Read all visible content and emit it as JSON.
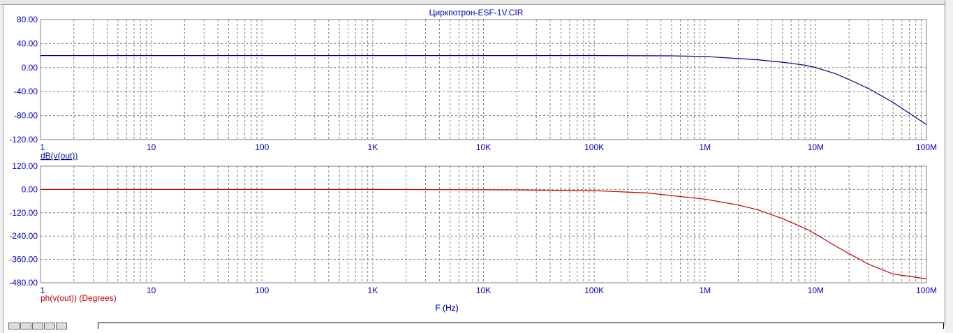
{
  "chart_data": [
    {
      "type": "line",
      "title": "Циркпотрон-ESF-1V.CIR",
      "xscale": "log",
      "xlim": [
        1,
        100000000
      ],
      "xticks": [
        "1",
        "10",
        "100",
        "1K",
        "10K",
        "100K",
        "1M",
        "10M",
        "100M"
      ],
      "xlabel": "F (Hz)",
      "ylabel": "dB(v(out))",
      "ylim": [
        -120,
        80
      ],
      "yticks": [
        "80.00",
        "40.00",
        "0.00",
        "-40.00",
        "-80.00",
        "-120.00"
      ],
      "grid": true,
      "series": [
        {
          "name": "dB(v(out))",
          "color": "#00008b",
          "x": [
            1,
            1000,
            100000,
            500000,
            1000000,
            2000000,
            3000000,
            5000000,
            8000000,
            10000000,
            15000000,
            20000000,
            30000000,
            50000000,
            100000000
          ],
          "y": [
            20,
            20,
            20,
            19.5,
            18.5,
            15,
            13,
            9,
            4,
            0,
            -10,
            -20,
            -35,
            -58,
            -95
          ]
        }
      ]
    },
    {
      "type": "line",
      "xscale": "log",
      "xlim": [
        1,
        100000000
      ],
      "xticks": [
        "1",
        "10",
        "100",
        "1K",
        "10K",
        "100K",
        "1M",
        "10M",
        "100M"
      ],
      "ylabel": "ph(v(out)) (Degrees)",
      "ylim": [
        -480,
        120
      ],
      "yticks": [
        "120.00",
        "0.00",
        "-120.00",
        "-240.00",
        "-360.00",
        "-480.00"
      ],
      "grid": true,
      "series": [
        {
          "name": "ph(v(out)) (Degrees)",
          "color": "#c00000",
          "x": [
            1,
            1000,
            20000,
            100000,
            300000,
            1000000,
            2000000,
            3000000,
            5000000,
            8000000,
            10000000,
            15000000,
            20000000,
            30000000,
            50000000,
            100000000
          ],
          "y": [
            0,
            0,
            -2,
            -6,
            -18,
            -50,
            -80,
            -105,
            -150,
            -200,
            -230,
            -290,
            -330,
            -385,
            -435,
            -460
          ]
        }
      ]
    }
  ]
}
